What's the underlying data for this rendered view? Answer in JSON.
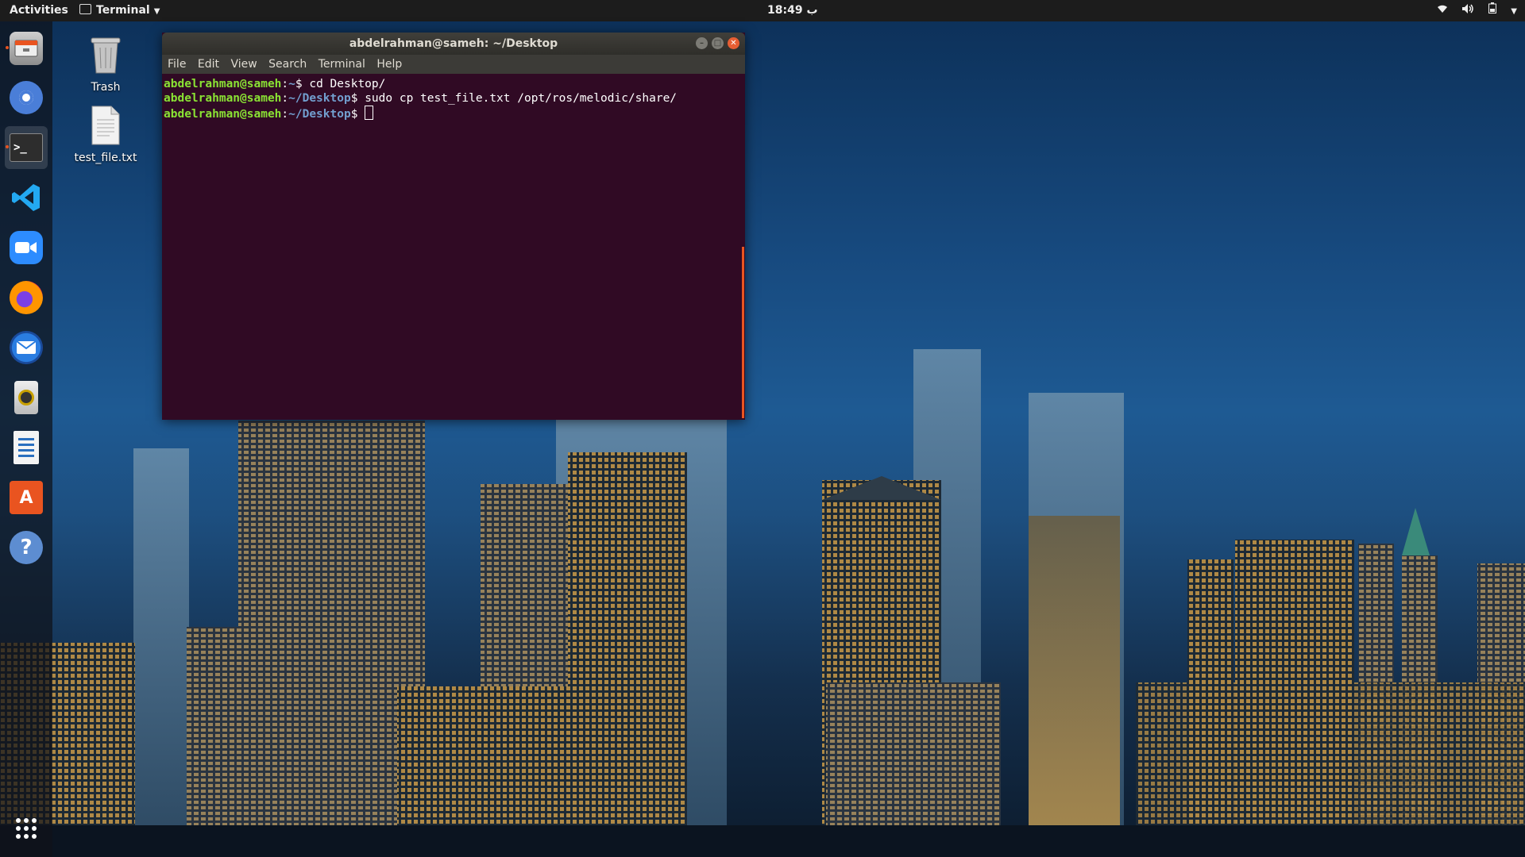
{
  "topbar": {
    "activities": "Activities",
    "app_menu": "Terminal",
    "clock": "18:49 ب"
  },
  "dock": {
    "items": [
      {
        "name": "files",
        "active": false
      },
      {
        "name": "chromium",
        "active": false
      },
      {
        "name": "terminal",
        "active": true
      },
      {
        "name": "vscode",
        "active": false
      },
      {
        "name": "zoom",
        "active": false
      },
      {
        "name": "firefox",
        "active": false
      },
      {
        "name": "thunderbird",
        "active": false
      },
      {
        "name": "rhythmbox",
        "active": false
      },
      {
        "name": "libreoffice-writer",
        "active": false
      },
      {
        "name": "ubuntu-software",
        "active": false
      },
      {
        "name": "help",
        "active": false
      }
    ],
    "help_glyph": "?"
  },
  "desktop": {
    "trash_label": "Trash",
    "file_label": "test_file.txt"
  },
  "terminal": {
    "title": "abdelrahman@sameh: ~/Desktop",
    "menu": [
      "File",
      "Edit",
      "View",
      "Search",
      "Terminal",
      "Help"
    ],
    "lines": [
      {
        "user": "abdelrahman@sameh",
        "path": "~",
        "command": "cd Desktop/"
      },
      {
        "user": "abdelrahman@sameh",
        "path": "~/Desktop",
        "command": "sudo cp test_file.txt /opt/ros/melodic/share/"
      },
      {
        "user": "abdelrahman@sameh",
        "path": "~/Desktop",
        "command": ""
      }
    ]
  },
  "colors": {
    "prompt_user": "#8ae234",
    "prompt_path": "#729fcf",
    "terminal_bg": "#300a24",
    "accent": "#e95420"
  }
}
